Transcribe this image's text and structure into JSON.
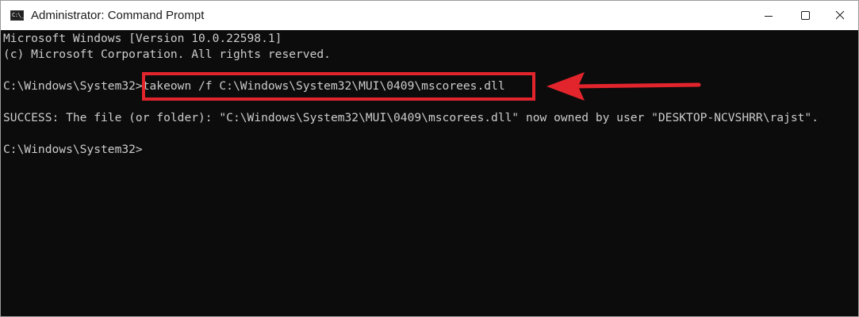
{
  "window": {
    "title": "Administrator: Command Prompt",
    "icon_text": "C:\\_",
    "controls": {
      "minimize_icon": "minimize-icon",
      "maximize_icon": "maximize-icon",
      "close_icon": "close-icon"
    }
  },
  "console": {
    "lines": [
      "Microsoft Windows [Version 10.0.22598.1]",
      "(c) Microsoft Corporation. All rights reserved.",
      "",
      "C:\\Windows\\System32>takeown /f C:\\Windows\\System32\\MUI\\0409\\mscorees.dll",
      "",
      "SUCCESS: The file (or folder): \"C:\\Windows\\System32\\MUI\\0409\\mscorees.dll\" now owned by user \"DESKTOP-NCVSHRR\\rajst\".",
      "",
      "C:\\Windows\\System32>"
    ]
  },
  "annotation": {
    "color": "#e2242c"
  }
}
